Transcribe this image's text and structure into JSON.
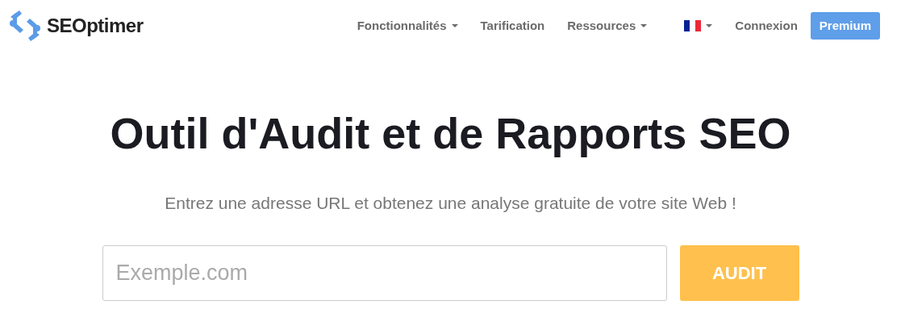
{
  "logo": {
    "text": "SEOptimer"
  },
  "nav": [
    {
      "label": "Fonctionnalités",
      "has_menu": true
    },
    {
      "label": "Tarification",
      "has_menu": false
    },
    {
      "label": "Ressources",
      "has_menu": true
    }
  ],
  "language": {
    "has_menu": true
  },
  "login": {
    "label": "Connexion"
  },
  "premium": {
    "label": "Premium"
  },
  "hero": {
    "title": "Outil d'Audit et de Rapports SEO",
    "subtitle": "Entrez une adresse URL et obtenez une analyse gratuite de votre site Web !"
  },
  "search": {
    "placeholder": "Exemple.com",
    "button": "AUDIT"
  }
}
